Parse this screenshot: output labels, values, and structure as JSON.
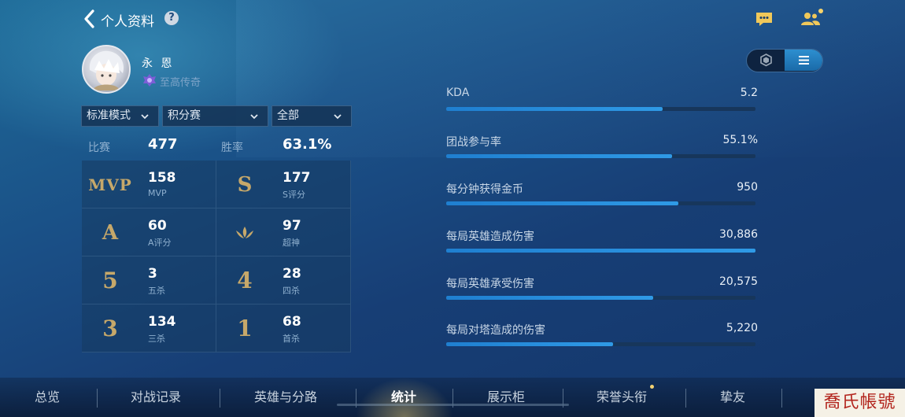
{
  "header": {
    "title": "个人资料",
    "help_label": "?"
  },
  "profile": {
    "name": "永 恩",
    "rank": "至高传奇"
  },
  "filters": {
    "mode": "标准模式",
    "match_type": "积分赛",
    "scope": "全部"
  },
  "summary": {
    "matches_label": "比赛",
    "matches_value": "477",
    "winrate_label": "胜率",
    "winrate_value": "63.1%"
  },
  "grid": [
    {
      "badge": "MVP",
      "value": "158",
      "label": "MVP"
    },
    {
      "badge": "S",
      "value": "177",
      "label": "S评分"
    },
    {
      "badge": "A",
      "value": "60",
      "label": "A评分"
    },
    {
      "badge": "legendary-icon",
      "value": "97",
      "label": "超神"
    },
    {
      "badge": "5",
      "value": "3",
      "label": "五杀"
    },
    {
      "badge": "4",
      "value": "28",
      "label": "四杀"
    },
    {
      "badge": "3",
      "value": "134",
      "label": "三杀"
    },
    {
      "badge": "1",
      "value": "68",
      "label": "首杀"
    }
  ],
  "stats": [
    {
      "label": "KDA",
      "value": "5.2",
      "fill": 0.7
    },
    {
      "label": "团战参与率",
      "value": "55.1%",
      "fill": 0.73
    },
    {
      "label": "每分钟获得金币",
      "value": "950",
      "fill": 0.75
    },
    {
      "label": "每局英雄造成伤害",
      "value": "30,886",
      "fill": 1.0
    },
    {
      "label": "每局英雄承受伤害",
      "value": "20,575",
      "fill": 0.67
    },
    {
      "label": "每局对塔造成的伤害",
      "value": "5,220",
      "fill": 0.54
    }
  ],
  "nav": {
    "items": [
      "总览",
      "对战记录",
      "英雄与分路",
      "统计",
      "展示柜",
      "荣誉头衔",
      "挚友"
    ],
    "active": "统计"
  },
  "watermark": "喬氏帳號",
  "colors": {
    "accent_bar": "#2f9ae6",
    "gold": "#c6a86a",
    "notify": "#f4d272"
  }
}
